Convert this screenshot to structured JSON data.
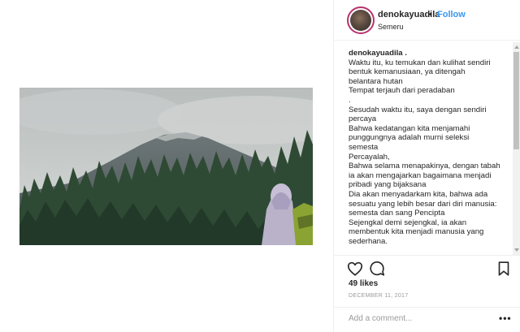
{
  "post": {
    "username": "denokayuadila",
    "separator": "•",
    "follow_label": "Follow",
    "location": "Semeru"
  },
  "caption": {
    "username": "denokayuadila .",
    "lines": [
      "Waktu itu, ku temukan dan kulihat sendiri",
      "bentuk kemanusiaan, ya ditengah",
      "belantara hutan",
      "Tempat terjauh dari peradaban",
      ".",
      "Sesudah waktu itu, saya dengan sendiri",
      "percaya",
      "Bahwa kedatangan kita menjamahi",
      "punggungnya adalah murni seleksi",
      "semesta",
      "Percayalah,",
      "Bahwa selama menapakinya, dengan tabah",
      "ia akan mengajarkan bagaimana menjadi",
      "pribadi yang bijaksana",
      "Dia akan menyadarkam kita, bahwa ada",
      "sesuatu yang lebih besar dari diri manusia:",
      "semesta dan sang Pencipta",
      "Sejengkal demi sejengkal, ia akan",
      "membentuk kita menjadi manusia yang",
      "sederhana."
    ]
  },
  "actions": {
    "likes": "49 likes",
    "date": "DECEMBER 11, 2017",
    "comment_placeholder": "Add a comment...",
    "more_label": "•••"
  },
  "icons": {
    "heart": "heart-icon",
    "comment": "comment-icon",
    "bookmark": "bookmark-icon"
  },
  "colors": {
    "follow": "#3897f0",
    "text": "#262626",
    "muted": "#999999",
    "avatar_ring": "#b8326e"
  }
}
